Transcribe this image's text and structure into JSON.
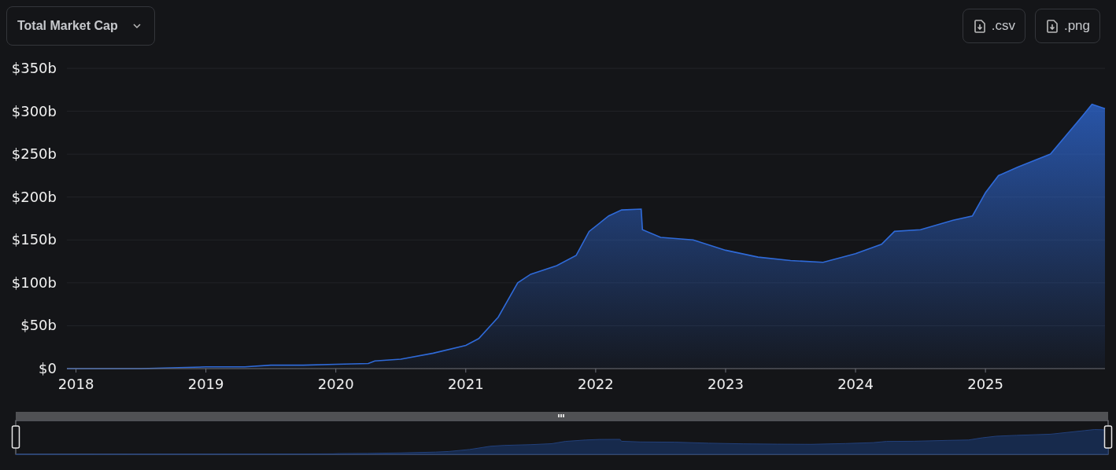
{
  "toolbar": {
    "metric_dropdown": {
      "label": "Total Market Cap"
    },
    "downloads": [
      {
        "label": ".csv"
      },
      {
        "label": ".png"
      }
    ]
  },
  "chart": {
    "chart_data": {
      "type": "area",
      "grid": true,
      "xlim": [
        2017.93,
        2025.92
      ],
      "ylim": [
        0,
        350
      ],
      "x": [
        2017.93,
        2018.5,
        2019.0,
        2019.3,
        2019.5,
        2019.75,
        2020.0,
        2020.25,
        2020.3,
        2020.5,
        2020.75,
        2021.0,
        2021.1,
        2021.25,
        2021.4,
        2021.5,
        2021.7,
        2021.85,
        2021.95,
        2022.1,
        2022.2,
        2022.35,
        2022.36,
        2022.5,
        2022.75,
        2023.0,
        2023.25,
        2023.5,
        2023.75,
        2024.0,
        2024.2,
        2024.3,
        2024.5,
        2024.75,
        2024.9,
        2025.0,
        2025.1,
        2025.25,
        2025.5,
        2025.75,
        2025.82,
        2025.92
      ],
      "series": [
        {
          "color": "#2f6ad8",
          "values": [
            0,
            0,
            2,
            2,
            4,
            4,
            5,
            6,
            9,
            11,
            18,
            27,
            35,
            60,
            100,
            110,
            120,
            132,
            160,
            178,
            185,
            186,
            162,
            153,
            150,
            138,
            130,
            126,
            124,
            134,
            145,
            160,
            162,
            173,
            178,
            205,
            225,
            235,
            250,
            295,
            308,
            303
          ]
        }
      ],
      "xticks": [
        {
          "value": 2018,
          "label": "2018"
        },
        {
          "value": 2019,
          "label": "2019"
        },
        {
          "value": 2020,
          "label": "2020"
        },
        {
          "value": 2021,
          "label": "2021"
        },
        {
          "value": 2022,
          "label": "2022"
        },
        {
          "value": 2023,
          "label": "2023"
        },
        {
          "value": 2024,
          "label": "2024"
        },
        {
          "value": 2025,
          "label": "2025"
        }
      ],
      "yticks": [
        {
          "value": 0,
          "label": "$0"
        },
        {
          "value": 50,
          "label": "$50b"
        },
        {
          "value": 100,
          "label": "$100b"
        },
        {
          "value": 150,
          "label": "$150b"
        },
        {
          "value": 200,
          "label": "$200b"
        },
        {
          "value": 250,
          "label": "$250b"
        },
        {
          "value": 300,
          "label": "$300b"
        },
        {
          "value": 350,
          "label": "$350b"
        }
      ]
    }
  }
}
